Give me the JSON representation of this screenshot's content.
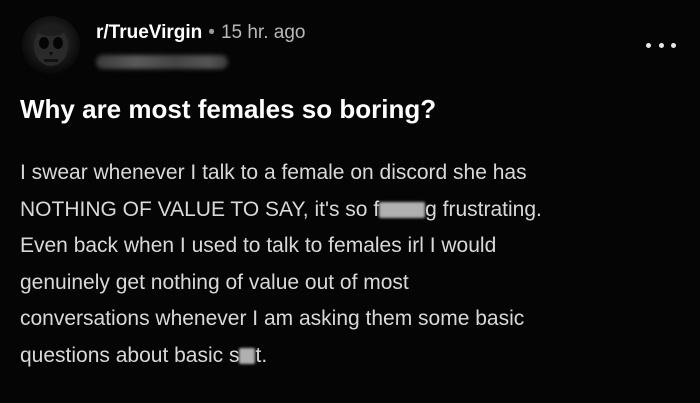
{
  "post": {
    "subreddit": "r/TrueVirgin",
    "separator": "•",
    "time": "15 hr. ago",
    "title": "Why are most females so boring?",
    "body": {
      "line1": "I swear whenever I talk to a female on discord she has",
      "line2_a": "NOTHING OF VALUE TO SAY, it's so f",
      "line2_b": "g frustrating.",
      "line3": "Even back when I used to talk to females irl I would",
      "line4": "genuinely get nothing of value out of most",
      "line5": "conversations whenever I am asking them some basic",
      "line6_a": "questions about basic s",
      "line6_b": "t."
    }
  },
  "icons": {
    "avatar": "avatar-image",
    "more": "more-options-icon"
  },
  "colors": {
    "background": "#050505",
    "title": "#ffffff",
    "body": "#d9d9d9",
    "meta": "#b8b8b8"
  }
}
